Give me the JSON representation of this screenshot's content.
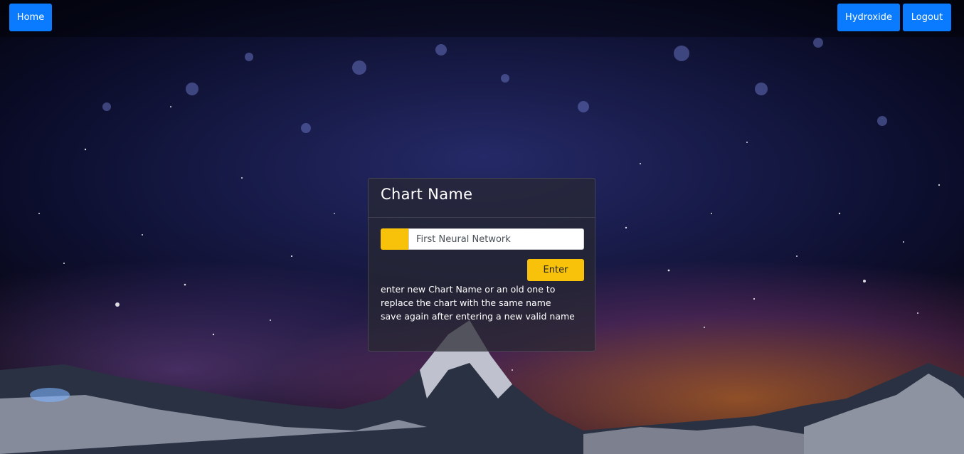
{
  "nav": {
    "home_label": "Home",
    "user_label": "Hydroxide",
    "logout_label": "Logout"
  },
  "card": {
    "title": "Chart Name",
    "input_value": "First Neural Network",
    "enter_label": "Enter",
    "help_line_1": "enter new Chart Name or an old one to replace the chart with the same name",
    "help_line_2": "save again after entering a new valid name"
  },
  "colors": {
    "nav_button": "#0a7bff",
    "accent": "#f9c20a",
    "card_bg": "rgba(40,40,50,0.72)"
  }
}
